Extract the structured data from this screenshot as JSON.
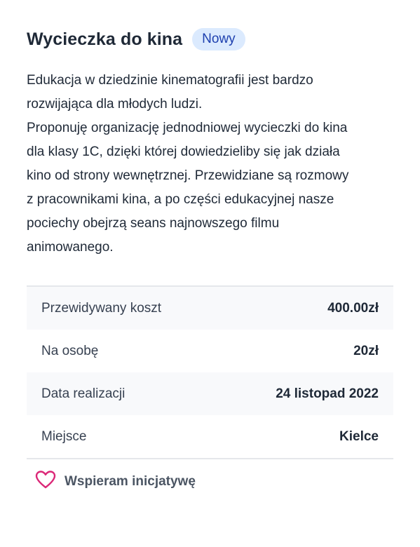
{
  "header": {
    "title": "Wycieczka do kina",
    "badge": "Nowy"
  },
  "description": {
    "lines": [
      "Edukacja w dziedzinie kinematografii jest bardzo",
      "rozwijająca dla młodych ludzi.",
      "Proponuję organizację jednodniowej wycieczki do kina",
      "dla klasy 1C, dzięki której dowiedzieliby się jak działa",
      "kino od strony wewnętrznej. Przewidziane są rozmowy",
      "z pracownikami kina, a po części edukacyjnej nasze",
      "pociechy obejrzą seans najnowszego filmu",
      "animowanego."
    ]
  },
  "details": {
    "rows": [
      {
        "label": "Przewidywany koszt",
        "value": "400.00zł"
      },
      {
        "label": "Na osobę",
        "value": "20zł"
      },
      {
        "label": "Data realizacji",
        "value": "24 listopad 2022"
      },
      {
        "label": "Miejsce",
        "value": "Kielce"
      }
    ]
  },
  "support": {
    "label": "Wspieram inicjatywę",
    "icon": "heart-icon",
    "icon_color": "#db2777"
  },
  "colors": {
    "badge_bg": "#dbeafe",
    "badge_text": "#1e40af",
    "row_shade": "#f8f9fb"
  }
}
